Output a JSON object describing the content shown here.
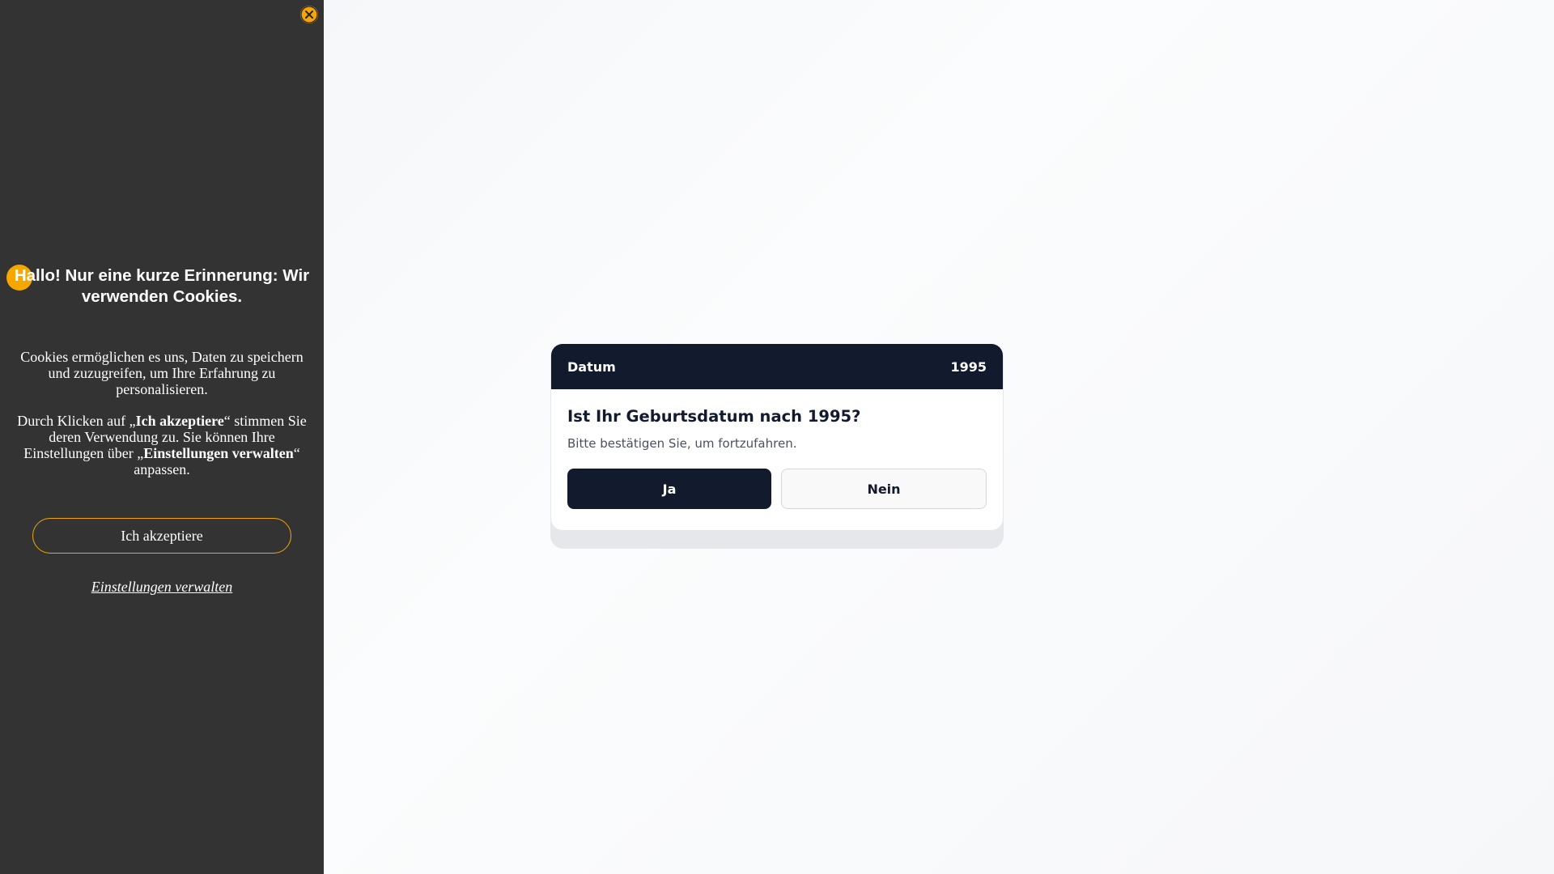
{
  "cookie_banner": {
    "title": "Hallo! Nur eine kurze Erinnerung: Wir verwenden Cookies.",
    "paragraph1": "Cookies ermöglichen es uns, Daten zu speichern und zuzugreifen, um Ihre Erfahrung zu personalisieren.",
    "paragraph2_part1": "Durch Klicken auf „",
    "paragraph2_accept_ref": "Ich akzeptiere",
    "paragraph2_part2": "“ stimmen Sie deren Verwendung zu. Sie können Ihre Einstellungen über „",
    "paragraph2_settings_ref": "Einstellungen verwalten",
    "paragraph2_part3": "“ anpassen.",
    "accept_label": "Ich akzeptiere",
    "settings_label": "Einstellungen verwalten",
    "close_icon": "close-icon",
    "accent_color": "#f5a700",
    "background_color": "#333333"
  },
  "age_gate": {
    "header_left": "Datum",
    "header_right": "1995",
    "question": "Ist Ihr Geburtsdatum nach 1995?",
    "hint": "Bitte bestätigen Sie, um fortzufahren.",
    "yes_label": "Ja",
    "no_label": "Nein",
    "header_color": "#121a2e"
  }
}
